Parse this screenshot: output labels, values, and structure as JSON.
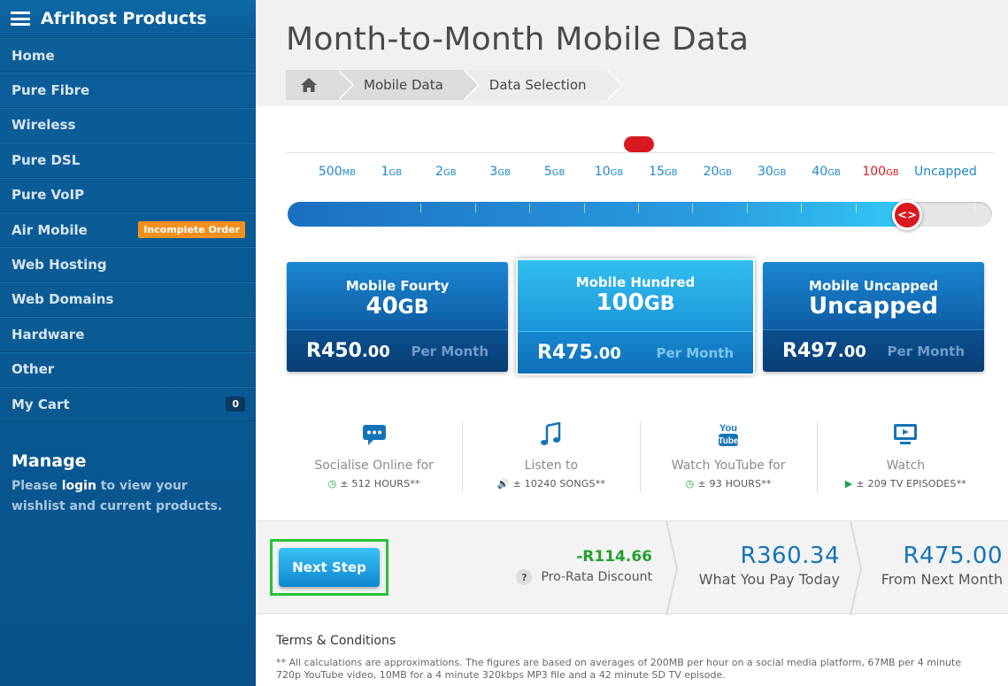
{
  "sidebar": {
    "title": "Afrihost Products",
    "items": [
      {
        "label": "Home"
      },
      {
        "label": "Pure Fibre"
      },
      {
        "label": "Wireless"
      },
      {
        "label": "Pure DSL"
      },
      {
        "label": "Pure VoIP"
      },
      {
        "label": "Air Mobile",
        "badge": "Incomplete Order"
      },
      {
        "label": "Web Hosting"
      },
      {
        "label": "Web Domains"
      },
      {
        "label": "Hardware"
      },
      {
        "label": "Other"
      },
      {
        "label": "My Cart",
        "count": "0"
      }
    ],
    "manage": {
      "title": "Manage",
      "text_before": "Please ",
      "link": "login",
      "text_after": " to view your wishlist and current products."
    }
  },
  "main": {
    "title": "Month-to-Month Mobile Data",
    "breadcrumb": {
      "home_icon": "home-icon",
      "items": [
        "Mobile Data",
        "Data Selection"
      ]
    },
    "slider": {
      "ticks": [
        {
          "num": "500",
          "unit": "MB"
        },
        {
          "num": "1",
          "unit": "GB"
        },
        {
          "num": "2",
          "unit": "GB"
        },
        {
          "num": "3",
          "unit": "GB"
        },
        {
          "num": "5",
          "unit": "GB"
        },
        {
          "num": "10",
          "unit": "GB"
        },
        {
          "num": "15",
          "unit": "GB"
        },
        {
          "num": "20",
          "unit": "GB"
        },
        {
          "num": "30",
          "unit": "GB"
        },
        {
          "num": "40",
          "unit": "GB"
        },
        {
          "num": "100",
          "unit": "GB"
        },
        {
          "num": "Uncapped",
          "unit": ""
        }
      ],
      "selected_index": 10,
      "accent_color": "#d9191f"
    },
    "plans": [
      {
        "name": "Mobile Fourty",
        "size_num": "40",
        "size_unit": "GB",
        "price": "R450",
        "cents": ".00",
        "period": "Per Month",
        "selected": false
      },
      {
        "name": "Mobile Hundred",
        "size_num": "100",
        "size_unit": "GB",
        "price": "R475",
        "cents": ".00",
        "period": "Per Month",
        "selected": true
      },
      {
        "name": "Mobile Uncapped",
        "size_num": "Uncapped",
        "size_unit": "",
        "price": "R497",
        "cents": ".00",
        "period": "Per Month",
        "selected": false
      }
    ],
    "usage": [
      {
        "icon": "chat-icon",
        "label": "Socialise Online for",
        "value_icon": "clock-icon",
        "value": "± 512 HOURS**"
      },
      {
        "icon": "music-icon",
        "label": "Listen to",
        "value_icon": "speaker-icon",
        "value": "± 10240 SONGS**"
      },
      {
        "icon": "youtube-icon",
        "label": "Watch YouTube for",
        "value_icon": "clock-icon",
        "value": "± 93 HOURS**"
      },
      {
        "icon": "tv-icon",
        "label": "Watch",
        "value_icon": "play-icon",
        "value": "± 209 TV EPISODES**"
      }
    ],
    "summary": {
      "next_button": "Next Step",
      "discount_value": "-R114.66",
      "discount_label": "Pro-Rata Discount",
      "today_value": "R360.34",
      "today_label": "What You Pay Today",
      "next_month_value": "R475.00",
      "next_month_label": "From Next Month"
    },
    "terms": {
      "title": "Terms & Conditions",
      "text": "** All calculations are approximations. The figures are based on averages of 200MB per hour on a social media platform, 67MB per 4 minute 720p YouTube video, 10MB for a 4 minute 320kbps MP3 file and a 42 minute SD TV episode."
    }
  }
}
